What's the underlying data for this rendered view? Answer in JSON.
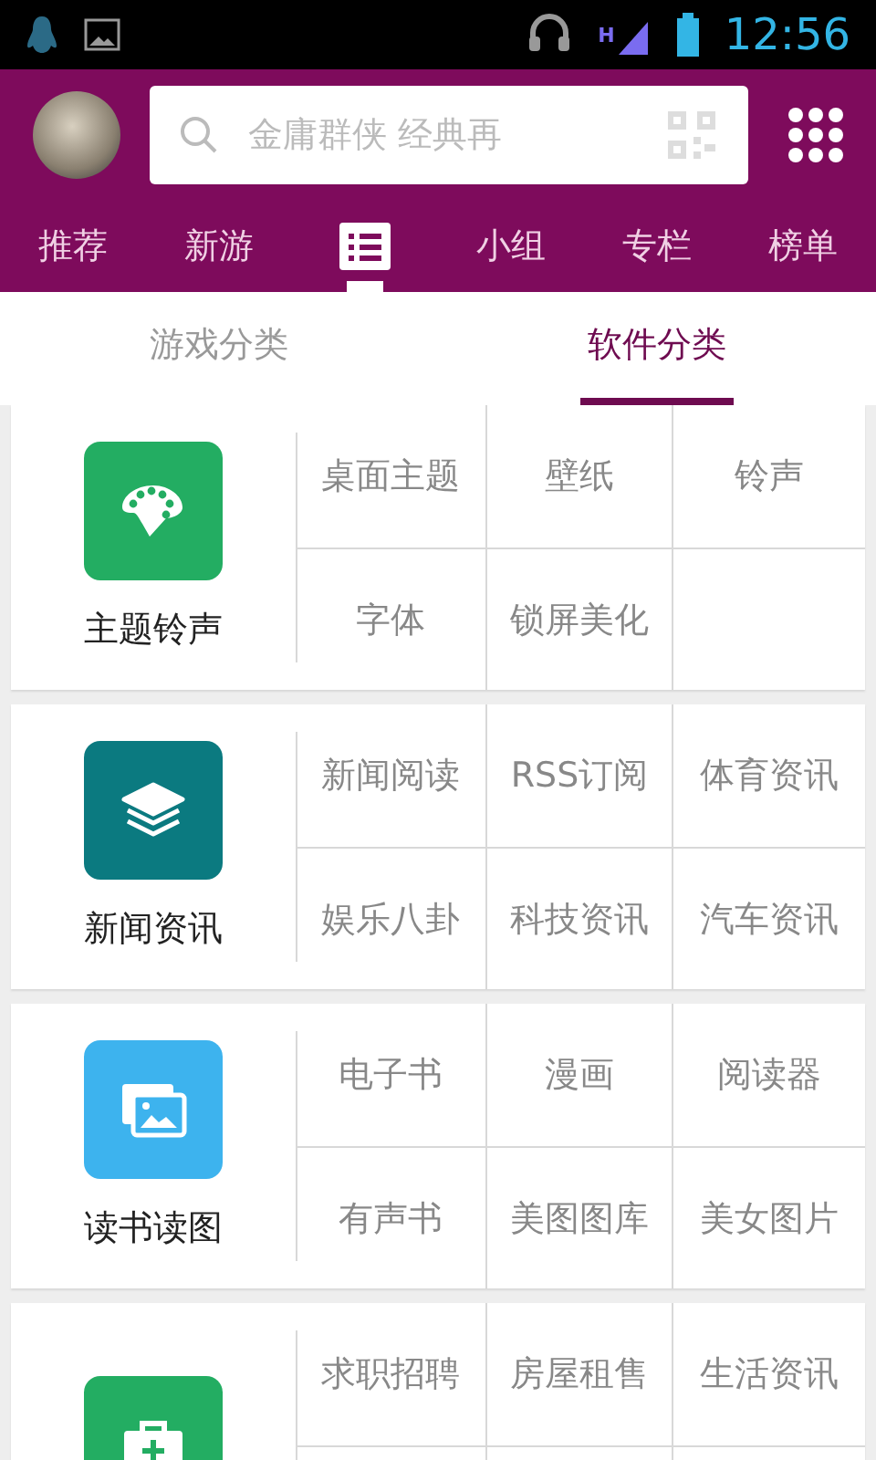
{
  "status_bar": {
    "network": "H",
    "time": "12:56"
  },
  "search": {
    "placeholder": "金庸群侠 经典再"
  },
  "tabs": [
    {
      "kind": "text",
      "label": "推荐",
      "selected": false
    },
    {
      "kind": "text",
      "label": "新游",
      "selected": false
    },
    {
      "kind": "icon",
      "selected": true
    },
    {
      "kind": "text",
      "label": "小组",
      "selected": false
    },
    {
      "kind": "text",
      "label": "专栏",
      "selected": false
    },
    {
      "kind": "text",
      "label": "榜单",
      "selected": false
    }
  ],
  "sub_tabs": [
    {
      "label": "游戏分类",
      "selected": false
    },
    {
      "label": "软件分类",
      "selected": true
    }
  ],
  "categories": [
    {
      "name": "主题铃声",
      "kind": "palette",
      "color": "#23ad62",
      "items": [
        "桌面主题",
        "壁纸",
        "铃声",
        "字体",
        "锁屏美化"
      ]
    },
    {
      "name": "新闻资讯",
      "kind": "layers",
      "color": "#0b7a80",
      "items": [
        "新闻阅读",
        "RSS订阅",
        "体育资讯",
        "娱乐八卦",
        "科技资讯",
        "汽车资讯"
      ]
    },
    {
      "name": "读书读图",
      "kind": "pictures",
      "color": "#3db3ee",
      "items": [
        "电子书",
        "漫画",
        "阅读器",
        "有声书",
        "美图图库",
        "美女图片"
      ]
    },
    {
      "kind": "kit",
      "color": "#23ad62",
      "items": [
        "求职招聘",
        "房屋租售",
        "生活资讯"
      ]
    }
  ]
}
